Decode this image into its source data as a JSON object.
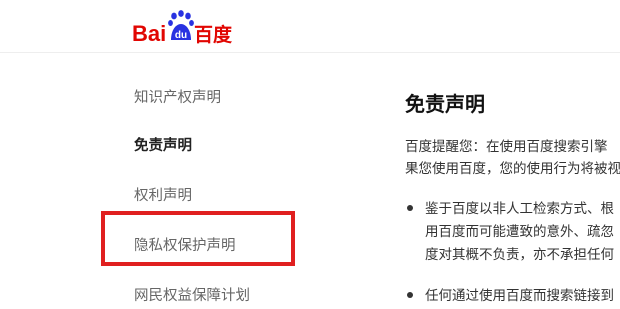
{
  "header": {
    "logo_text_bai": "Bai",
    "logo_text_du": "du",
    "logo_text_cn": "百度",
    "logo_color_red": "#e10602",
    "logo_color_blue": "#2932e1"
  },
  "sidebar": {
    "items": [
      {
        "label": "知识产权声明"
      },
      {
        "label": "免责声明"
      },
      {
        "label": "权利声明"
      },
      {
        "label": "隐私权保护声明"
      },
      {
        "label": "网民权益保障计划"
      }
    ]
  },
  "main": {
    "title": "免责声明",
    "intro_lines": [
      "百度提醒您：在使用百度搜索引擎",
      "果您使用百度，您的使用行为将被视"
    ],
    "bullets": [
      {
        "lines": [
          "鉴于百度以非人工检索方式、根",
          "用百度而可能遭致的意外、疏忽",
          "度对其概不负责，亦不承担任何"
        ]
      },
      {
        "lines": [
          "任何通过使用百度而搜索链接到"
        ]
      }
    ]
  },
  "colors": {
    "highlight": "#e02020"
  }
}
